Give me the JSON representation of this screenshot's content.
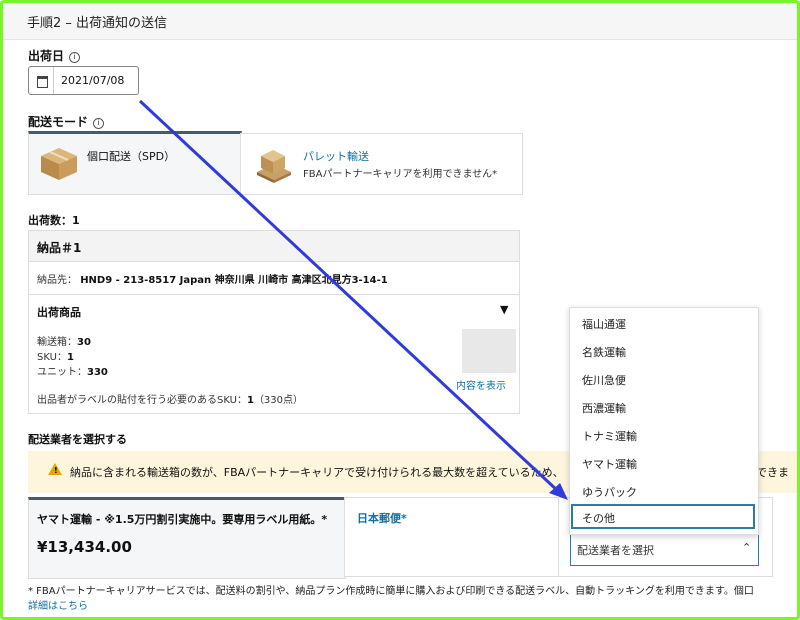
{
  "header": {
    "title": "手順2 – 出荷通知の送信"
  },
  "ship_date": {
    "label": "出荷日",
    "value": "2021/07/08"
  },
  "shipping_mode": {
    "label": "配送モード",
    "options": [
      {
        "title": "個口配送（SPD）",
        "subtitle": ""
      },
      {
        "title": "パレット輸送",
        "subtitle": "FBAパートナーキャリアを利用できません*"
      }
    ]
  },
  "shipment_count": {
    "label": "出荷数：1"
  },
  "shipment": {
    "title": "納品＃1",
    "ship_to_label": "納品先：",
    "ship_to_value": "HND9 - 213-8517 Japan 神奈川県 川崎市 高津区北見方3-14-1",
    "products_label": "出荷商品",
    "boxes_label": "輸送箱：",
    "boxes_value": "30",
    "sku_label": "SKU：",
    "sku_value": "1",
    "units_label": "ユニット：",
    "units_value": "330",
    "show_contents": "内容を表示",
    "labels_note_prefix": "出品者がラベルの貼付を行う必要のあるSKU：",
    "labels_note_bold": "1",
    "labels_note_suffix": "（330点）"
  },
  "carrier": {
    "label": "配送業者を選択する",
    "warning": "納品に含まれる輸送箱の数が、FBAパートナーキャリアで受け付けられる最大数を超えているため、",
    "warning_tail": "できま",
    "cards": [
      {
        "name": "ヤマト運輸 - ※1.5万円割引実施中。要専用ラベル用紙。*",
        "price": "¥13,434.00"
      },
      {
        "name": "日本郵便*"
      }
    ],
    "select_placeholder": "配送業者を選択",
    "dropdown_items": [
      "福山通運",
      "名鉄運輸",
      "佐川急便",
      "西濃運輸",
      "トナミ運輸",
      "ヤマト運輸",
      "ゆうパック",
      "その他"
    ]
  },
  "footer": {
    "note": "* FBAパートナーキャリアサービスでは、配送料の割引や、納品プラン作成時に簡単に購入および印刷できる配送ラベル、自動トラッキングを利用できます。個口",
    "link": "詳細はこちら"
  },
  "colors": {
    "accent": "#0f6fa6",
    "annotation": "#2f3bdc",
    "frame": "#7bf22a",
    "warning_bg": "#fdf6dd"
  }
}
